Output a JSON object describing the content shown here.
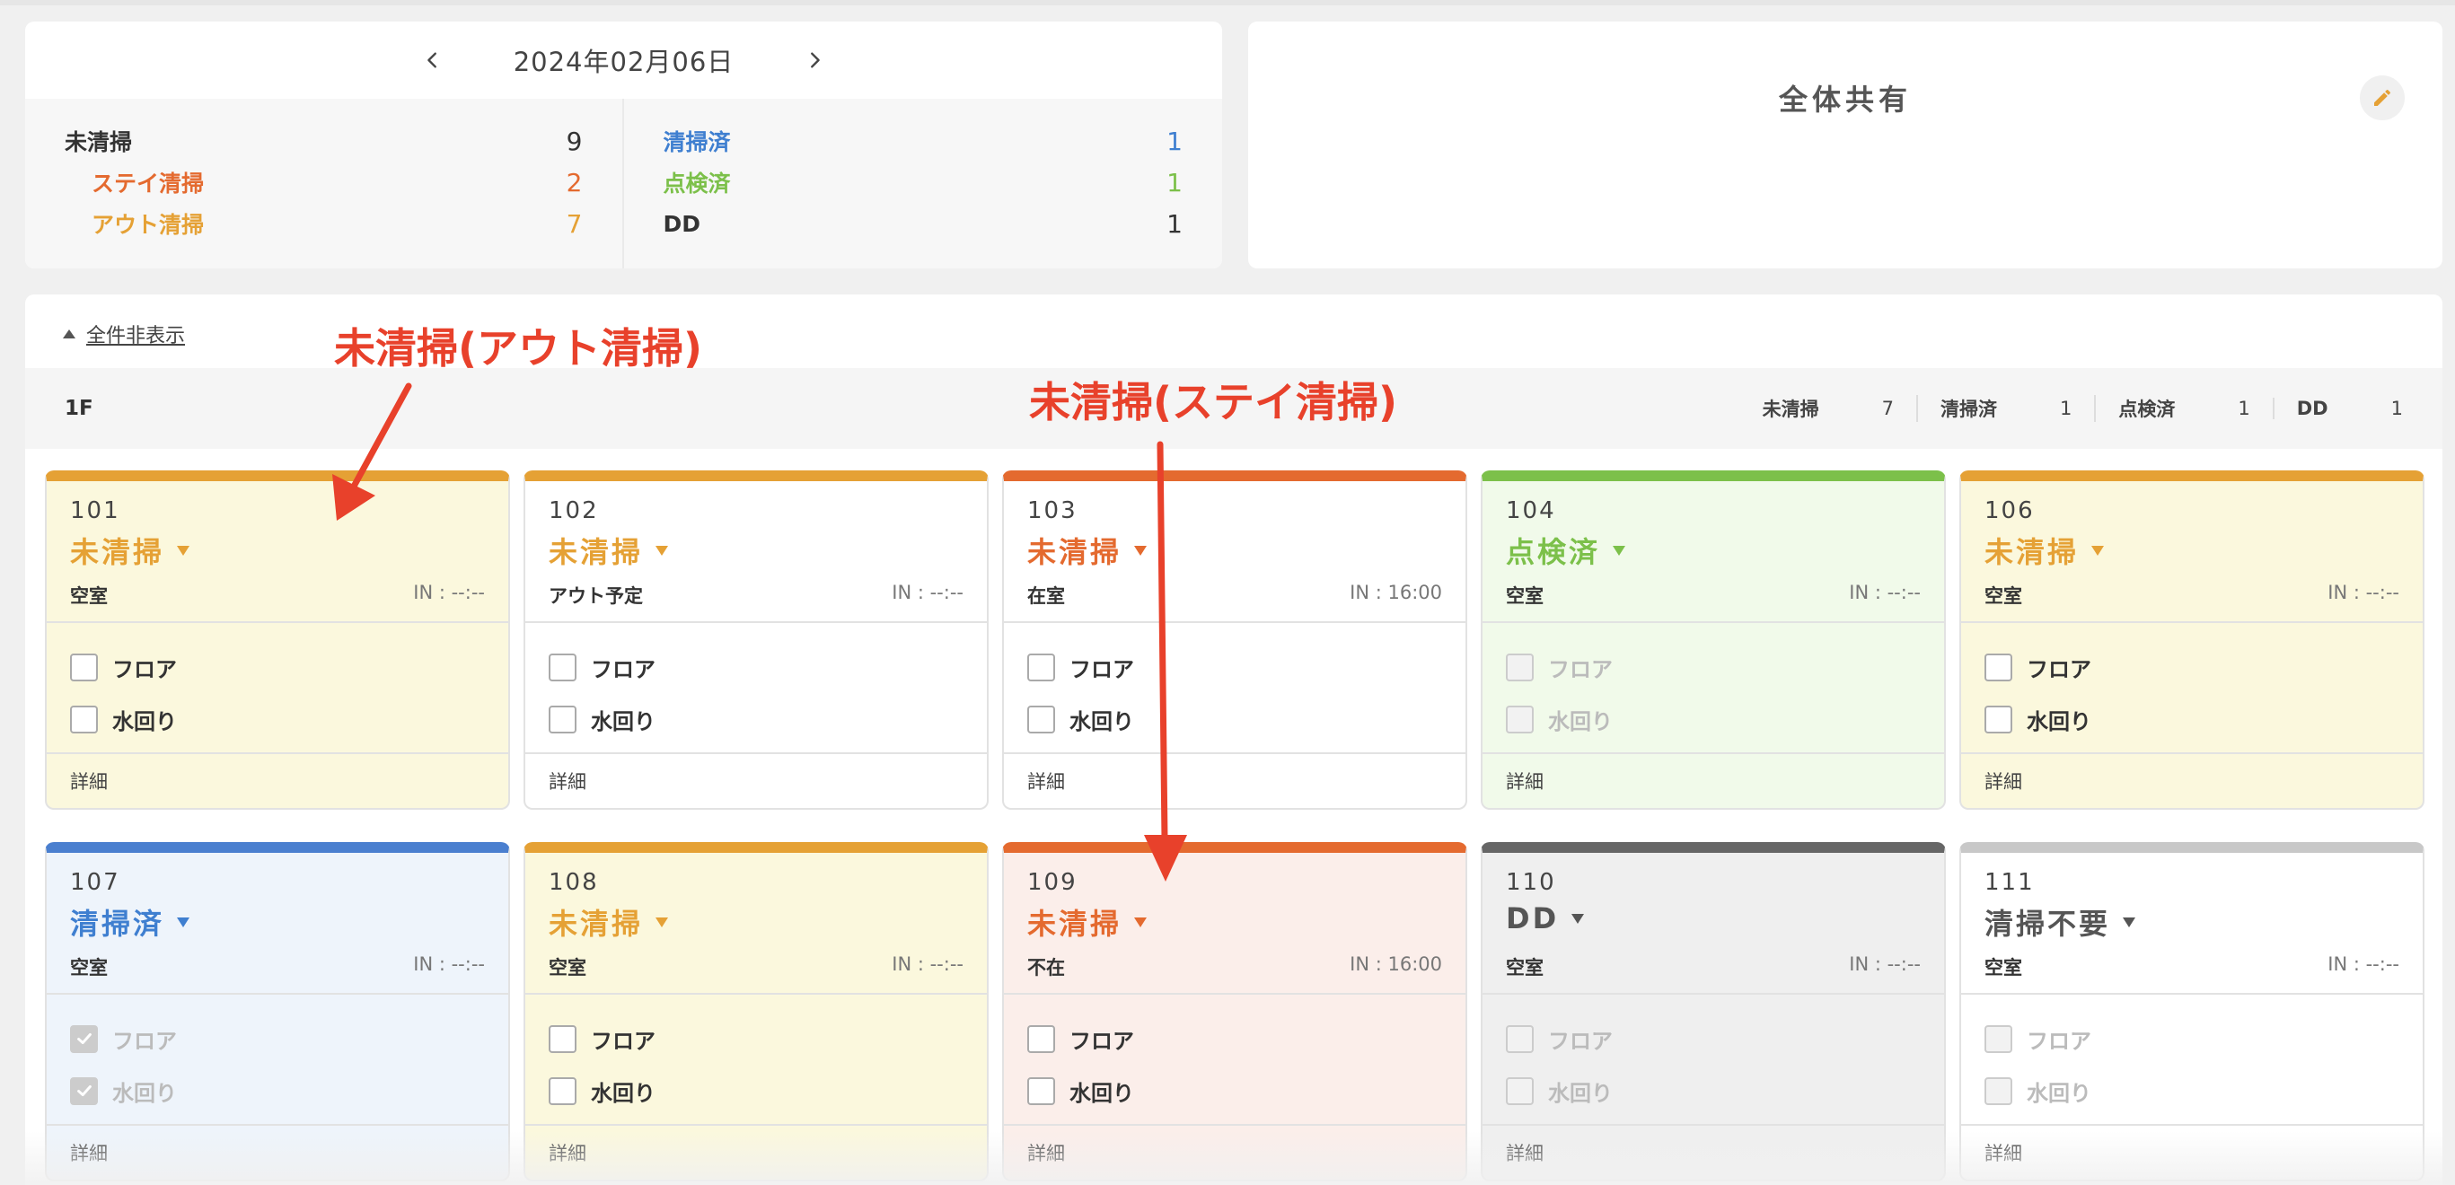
{
  "date": {
    "label": "2024年02月06日"
  },
  "summary": {
    "left": [
      {
        "label": "未清掃",
        "value": "9",
        "color": "#333333",
        "indent": false
      },
      {
        "label": "ステイ清掃",
        "value": "2",
        "color": "#e46a2f",
        "indent": true
      },
      {
        "label": "アウト清掃",
        "value": "7",
        "color": "#e5a135",
        "indent": true
      }
    ],
    "right": [
      {
        "label": "清掃済",
        "value": "1",
        "color": "#3f7fd0",
        "indent": false
      },
      {
        "label": "点検済",
        "value": "1",
        "color": "#7cc04a",
        "indent": false
      },
      {
        "label": "DD",
        "value": "1",
        "color": "#333333",
        "indent": false
      }
    ]
  },
  "share": {
    "title": "全体共有"
  },
  "rooms_panel": {
    "collapse_label": "全件非表示",
    "floor": {
      "name": "1F",
      "stats": [
        {
          "label": "未清掃",
          "value": "7"
        },
        {
          "label": "清掃済",
          "value": "1"
        },
        {
          "label": "点検済",
          "value": "1"
        },
        {
          "label": "DD",
          "value": "1"
        }
      ]
    }
  },
  "check_labels": {
    "floor": "フロア",
    "water": "水回り"
  },
  "detail_label": "詳細",
  "rooms": [
    {
      "number": "101",
      "status": "未清掃",
      "occupancy": "空室",
      "checkin": "IN : --:--",
      "top_color": "#e5a135",
      "status_color": "#e5a135",
      "bg": "#fbf8dd",
      "disabled": false,
      "floor_checked": false,
      "water_checked": false
    },
    {
      "number": "102",
      "status": "未清掃",
      "occupancy": "アウト予定",
      "checkin": "IN : --:--",
      "top_color": "#e5a135",
      "status_color": "#e5a135",
      "bg": "#ffffff",
      "disabled": false,
      "floor_checked": false,
      "water_checked": false
    },
    {
      "number": "103",
      "status": "未清掃",
      "occupancy": "在室",
      "checkin": "IN : 16:00",
      "top_color": "#e46a2f",
      "status_color": "#e46a2f",
      "bg": "#ffffff",
      "disabled": false,
      "floor_checked": false,
      "water_checked": false
    },
    {
      "number": "104",
      "status": "点検済",
      "occupancy": "空室",
      "checkin": "IN : --:--",
      "top_color": "#7cc04a",
      "status_color": "#7cc04a",
      "bg": "#f1faea",
      "disabled": true,
      "floor_checked": false,
      "water_checked": false
    },
    {
      "number": "106",
      "status": "未清掃",
      "occupancy": "空室",
      "checkin": "IN : --:--",
      "top_color": "#e5a135",
      "status_color": "#e5a135",
      "bg": "#fbf8dd",
      "disabled": false,
      "floor_checked": false,
      "water_checked": false
    },
    {
      "number": "107",
      "status": "清掃済",
      "occupancy": "空室",
      "checkin": "IN : --:--",
      "top_color": "#4a7fcf",
      "status_color": "#3f7fd0",
      "bg": "#eef4fb",
      "disabled": true,
      "floor_checked": true,
      "water_checked": true
    },
    {
      "number": "108",
      "status": "未清掃",
      "occupancy": "空室",
      "checkin": "IN : --:--",
      "top_color": "#e5a135",
      "status_color": "#e5a135",
      "bg": "#fbf8dd",
      "disabled": false,
      "floor_checked": false,
      "water_checked": false
    },
    {
      "number": "109",
      "status": "未清掃",
      "occupancy": "不在",
      "checkin": "IN : 16:00",
      "top_color": "#e46a2f",
      "status_color": "#e46a2f",
      "bg": "#fbeeea",
      "disabled": false,
      "floor_checked": false,
      "water_checked": false
    },
    {
      "number": "110",
      "status": "DD",
      "occupancy": "空室",
      "checkin": "IN : --:--",
      "top_color": "#666666",
      "status_color": "#555555",
      "bg": "#efefef",
      "disabled": true,
      "floor_checked": false,
      "water_checked": false
    },
    {
      "number": "111",
      "status": "清掃不要",
      "occupancy": "空室",
      "checkin": "IN : --:--",
      "top_color": "#c8c8c8",
      "status_color": "#555555",
      "bg": "#ffffff",
      "disabled": true,
      "floor_checked": false,
      "water_checked": false
    }
  ],
  "annotations": [
    {
      "text": "未清掃(アウト清掃)",
      "color": "#e8412b"
    },
    {
      "text": "未清掃(ステイ清掃)",
      "color": "#e8412b"
    }
  ]
}
